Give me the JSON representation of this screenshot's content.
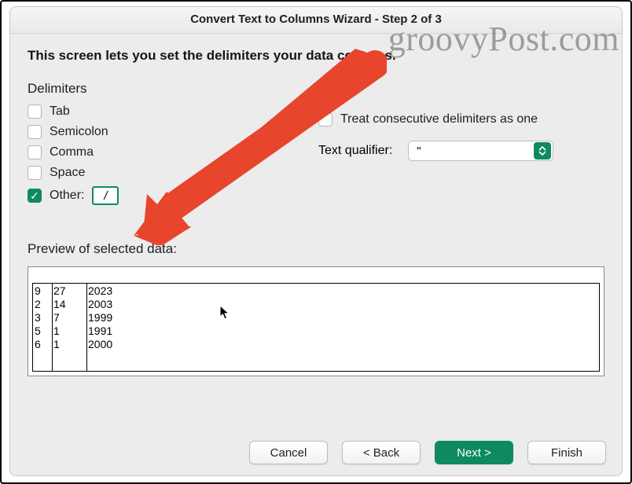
{
  "window": {
    "title": "Convert Text to Columns Wizard - Step 2 of 3"
  },
  "instruction": "This screen lets you set the delimiters your data contains.",
  "delimiters": {
    "heading": "Delimiters",
    "tab": "Tab",
    "semicolon": "Semicolon",
    "comma": "Comma",
    "space": "Space",
    "other_label": "Other:",
    "other_value": "/"
  },
  "options": {
    "treat_consecutive": "Treat consecutive delimiters as one",
    "text_qualifier_label": "Text qualifier:",
    "text_qualifier_value": "\""
  },
  "preview": {
    "label": "Preview of selected data:",
    "rows": [
      [
        "9",
        "27",
        "2023"
      ],
      [
        "2",
        "14",
        "2003"
      ],
      [
        "3",
        "7",
        "1999"
      ],
      [
        "5",
        "1",
        "1991"
      ],
      [
        "6",
        "1",
        "2000"
      ]
    ]
  },
  "buttons": {
    "cancel": "Cancel",
    "back": "< Back",
    "next": "Next >",
    "finish": "Finish"
  },
  "watermark": "groovyPost.com"
}
